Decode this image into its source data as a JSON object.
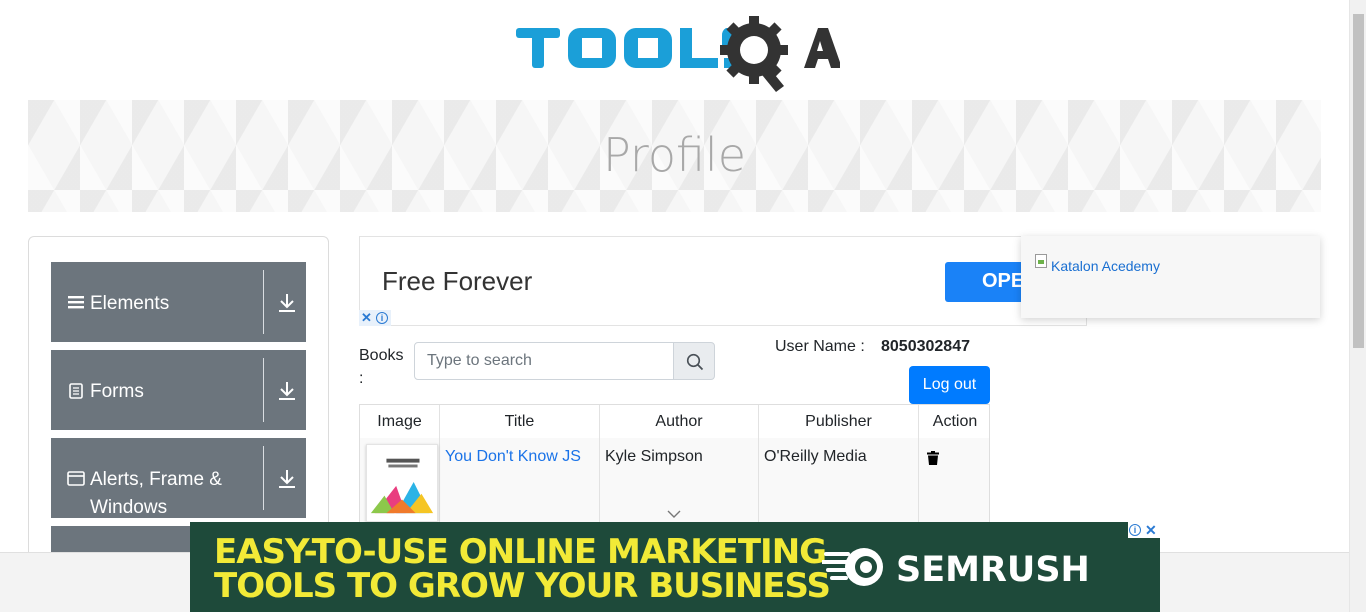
{
  "header": {
    "logo_alt": "TOOLSQA"
  },
  "banner": {
    "title": "Profile"
  },
  "sidebar": {
    "groups": [
      {
        "label": "Elements",
        "icon": "hamburger-icon"
      },
      {
        "label": "Forms",
        "icon": "document-icon"
      },
      {
        "label": "Alerts, Frame & Windows",
        "icon": "window-icon"
      }
    ]
  },
  "ad_top": {
    "text": "Free Forever",
    "button": "OPE"
  },
  "katalon": {
    "alt": "Katalon Acedemy"
  },
  "books": {
    "label": "Books :",
    "search_placeholder": "Type to search"
  },
  "user": {
    "label": "User Name :",
    "value": "8050302847",
    "logout": "Log out"
  },
  "table": {
    "headers": [
      "Image",
      "Title",
      "Author",
      "Publisher",
      "Action"
    ],
    "rows": [
      {
        "title": "You Don't Know JS",
        "author": "Kyle Simpson",
        "publisher": "O'Reilly Media"
      }
    ]
  },
  "ad_bottom": {
    "line1": "EASY-TO-USE ONLINE MARKETING",
    "line2": "TOOLS TO GROW YOUR BUSINESS",
    "brand": "SEMRUSH"
  },
  "colors": {
    "primary": "#007bff",
    "menu_bg": "#6c757d",
    "ad_yellow": "#f2ea37",
    "ad_green": "#1e4a3a"
  }
}
